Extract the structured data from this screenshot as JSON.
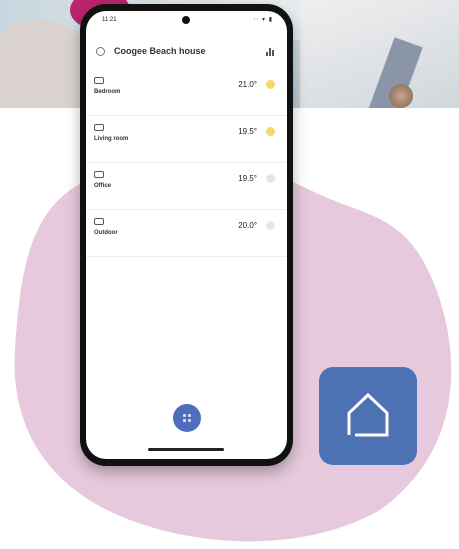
{
  "phone": {
    "status_time": "11:21",
    "status_icons": "⋅⋅ ▾ ▮",
    "home_title": "Coogee Beach house",
    "rooms": [
      {
        "name": "Bedroom",
        "temp": "21.0°",
        "icon": "bed-icon",
        "sun_color": "#f5d96a"
      },
      {
        "name": "Living room",
        "temp": "19.5°",
        "icon": "sofa-icon",
        "sun_color": "#f5d96a"
      },
      {
        "name": "Office",
        "temp": "19.5°",
        "icon": "desk-icon",
        "sun_color": "#e6e6e6"
      },
      {
        "name": "Outdoor",
        "temp": "20.0°",
        "icon": "outdoor-icon",
        "sun_color": "#e6e6e6"
      }
    ],
    "fab_icon": "grid-dots-icon"
  },
  "colors": {
    "blob": "#e6c9dc",
    "accent": "#4e6dbd",
    "home_tile": "#4c72b3"
  },
  "decor": {
    "home_tile_icon": "house-outline-icon"
  }
}
